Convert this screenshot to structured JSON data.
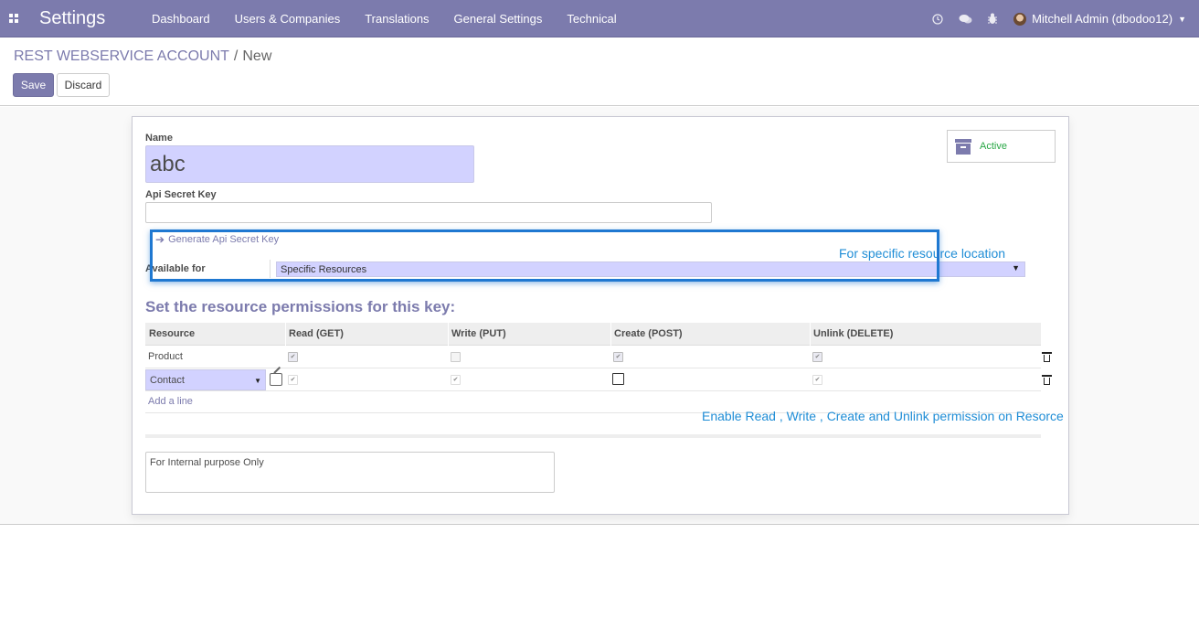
{
  "navbar": {
    "brand": "Settings",
    "menu": [
      "Dashboard",
      "Users & Companies",
      "Translations",
      "General Settings",
      "Technical"
    ],
    "user": "Mitchell Admin (dbodoo12)",
    "tray_icons": [
      "clock-icon",
      "chat-icon",
      "bug-icon"
    ]
  },
  "breadcrumb": {
    "root": "REST WEBSERVICE ACCOUNT",
    "separator": "/",
    "current": "New"
  },
  "buttons": {
    "save": "Save",
    "discard": "Discard"
  },
  "form": {
    "name_label": "Name",
    "name_value": "abc",
    "secret_label": "Api Secret Key",
    "secret_value": "",
    "generate_link": "Generate Api Secret Key",
    "active_label": "Active",
    "available_label": "Available for",
    "available_value": "Specific Resources",
    "section_title": "Set the resource permissions for this key:",
    "notes_placeholder": "For Internal purpose Only"
  },
  "table": {
    "headers": [
      "Resource",
      "Read (GET)",
      "Write (PUT)",
      "Create (POST)",
      "Unlink (DELETE)"
    ],
    "rows": [
      {
        "resource": "Product",
        "read": true,
        "write": false,
        "create": true,
        "unlink": true
      },
      {
        "resource": "Contact",
        "read": true,
        "write": true,
        "create": false,
        "unlink": true
      }
    ],
    "add_line": "Add a line"
  },
  "annotations": {
    "location": "For specific resource location",
    "permissions": "Enable Read , Write , Create and Unlink permission on Resorce"
  },
  "colors": {
    "brand": "#7c7bad",
    "required_field": "#d2d2ff",
    "annotation": "#1f8dd6",
    "active": "#28a745"
  }
}
